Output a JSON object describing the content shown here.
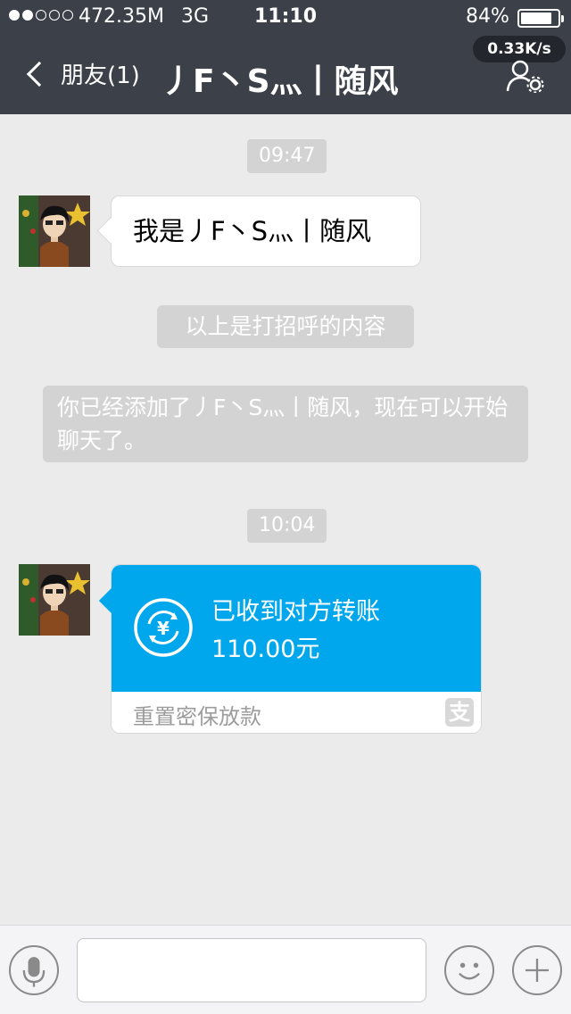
{
  "status_bar": {
    "memory": "472.35M",
    "network": "3G",
    "time": "11:10",
    "battery": "84%",
    "battery_level": 0.84
  },
  "header": {
    "back_label": "朋友(1)",
    "title": "丿F丶S灬丨随风",
    "speed": "0.33K/s",
    "icons": {
      "back": "back-arrow-icon",
      "profile": "friend-settings-icon"
    }
  },
  "messages": {
    "timestamp1": "09:47",
    "greeting": "我是丿F丶S灬丨随风",
    "system_note1": "以上是打招呼的内容",
    "system_note2": "你已经添加了丿F丶S灬丨随风，现在可以开始聊天了。",
    "timestamp2": "10:04",
    "transfer": {
      "title": "已收到对方转账",
      "amount": "110.00元",
      "footer": "重置密保放款",
      "brand_glyph": "支",
      "icon": "yuan-transfer-icon"
    }
  },
  "input_bar": {
    "input_value": "",
    "icons": {
      "voice": "microphone-icon",
      "emoji": "emoji-icon",
      "more": "plus-icon"
    }
  },
  "colors": {
    "header_bg": "#3b4049",
    "transfer_blue": "#01a7ec",
    "background": "#ebebeb"
  }
}
